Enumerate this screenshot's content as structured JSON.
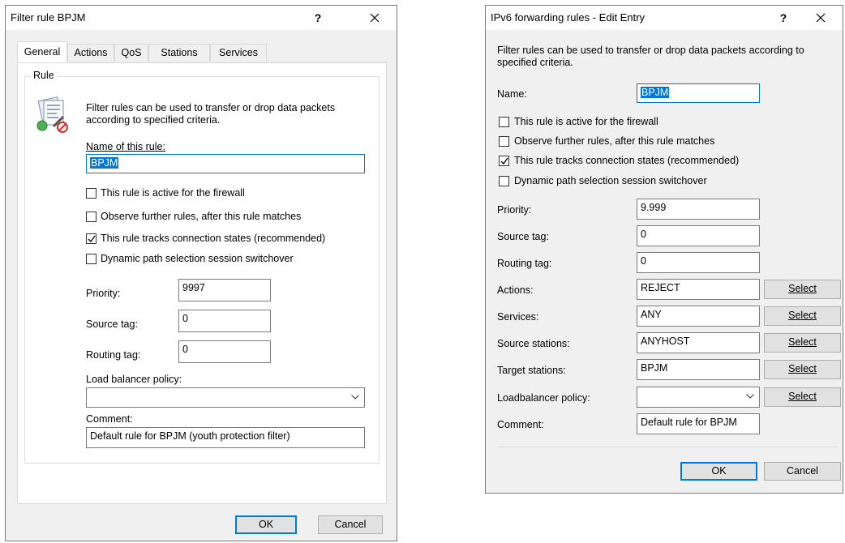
{
  "left_dialog": {
    "title": "Filter rule BPJM",
    "tabs": [
      {
        "label": "General"
      },
      {
        "label": "Actions"
      },
      {
        "label": "QoS"
      },
      {
        "label": "Stations"
      },
      {
        "label": "Services"
      }
    ],
    "group_label": "Rule",
    "description": "Filter rules can be used to transfer or drop data packets according to specified criteria.",
    "name_label": "Name of this rule:",
    "name_value": "BPJM",
    "checkboxes": [
      {
        "label": "This rule is active for the firewall",
        "checked": false
      },
      {
        "label": "Observe further rules, after this rule matches",
        "checked": false
      },
      {
        "label": "This rule tracks connection states (recommended)",
        "checked": true
      },
      {
        "label": "Dynamic path selection session switchover",
        "checked": false
      }
    ],
    "priority_label": "Priority:",
    "priority_value": "9997",
    "source_tag_label": "Source tag:",
    "source_tag_value": "0",
    "routing_tag_label": "Routing tag:",
    "routing_tag_value": "0",
    "lb_label": "Load balancer policy:",
    "lb_value": "",
    "comment_label": "Comment:",
    "comment_value": "Default rule for BPJM (youth protection filter)",
    "ok_label": "OK",
    "cancel_label": "Cancel",
    "help_label": "?"
  },
  "right_dialog": {
    "title": "IPv6 forwarding rules - Edit Entry",
    "description": "Filter rules can be used to transfer or drop data packets according to specified criteria.",
    "name_label": "Name:",
    "name_value": "BPJM",
    "checkboxes": [
      {
        "label": "This rule is active for the firewall",
        "checked": false
      },
      {
        "label": "Observe further rules, after this rule matches",
        "checked": false
      },
      {
        "label": "This rule tracks connection states (recommended)",
        "checked": true
      },
      {
        "label": "Dynamic path selection session switchover",
        "checked": false
      }
    ],
    "fields": [
      {
        "label": "Priority:",
        "value": "9.999"
      },
      {
        "label": "Source tag:",
        "value": "0"
      },
      {
        "label": "Routing tag:",
        "value": "0"
      }
    ],
    "select_fields": [
      {
        "label": "Actions:",
        "value": "REJECT"
      },
      {
        "label": "Services:",
        "value": "ANY"
      },
      {
        "label": "Source stations:",
        "value": "ANYHOST"
      },
      {
        "label": "Target stations:",
        "value": "BPJM"
      }
    ],
    "lb_label": "Loadbalancer policy:",
    "lb_value": "",
    "comment_label": "Comment:",
    "comment_value": "Default rule for BPJM",
    "select_label": "Select",
    "ok_label": "OK",
    "cancel_label": "Cancel",
    "help_label": "?"
  }
}
